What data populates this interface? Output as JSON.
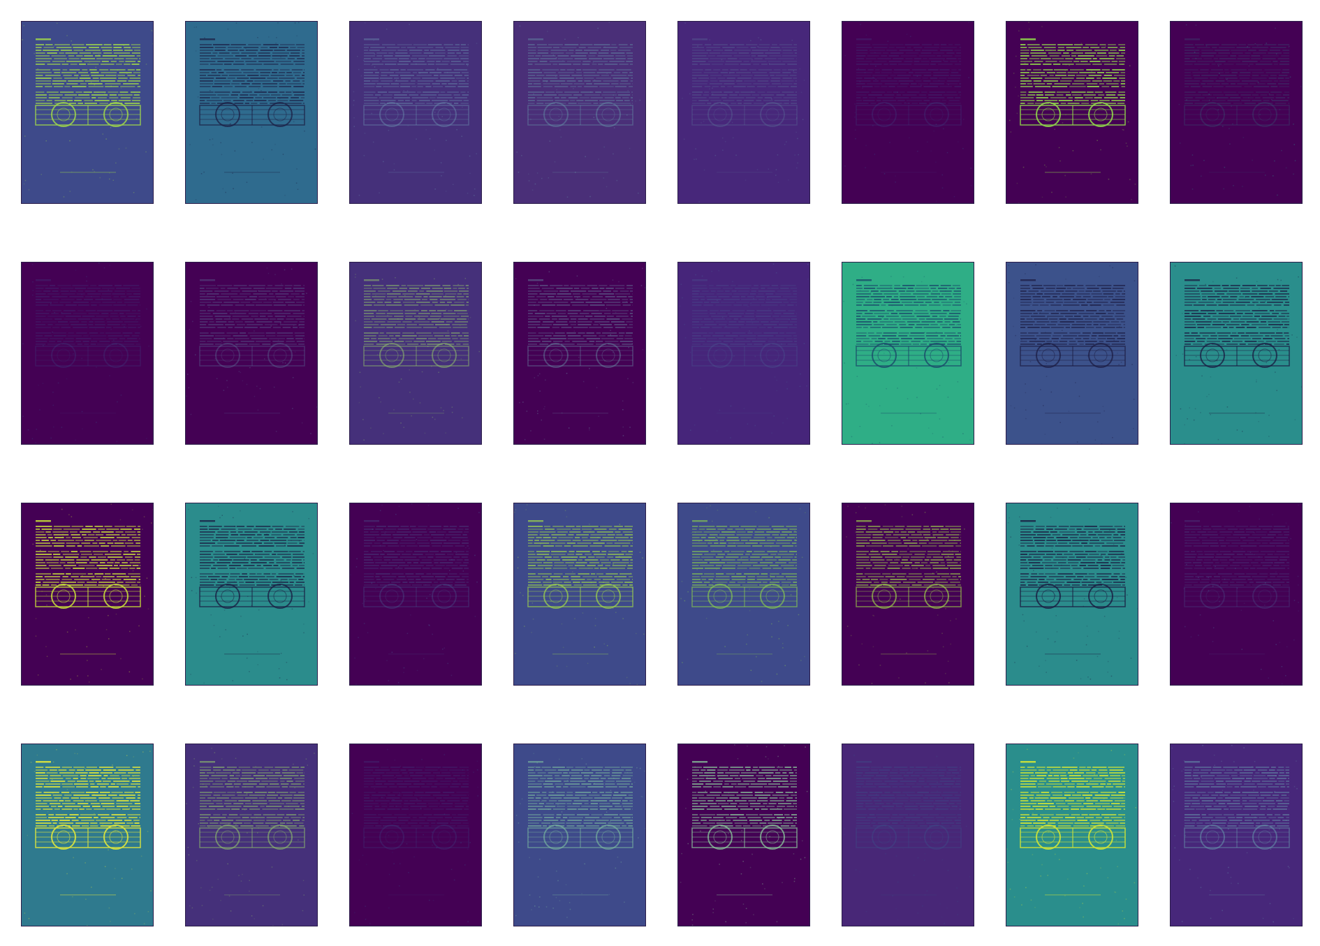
{
  "colormap": "viridis",
  "colormap_stops": [
    "#440154",
    "#482777",
    "#3f4a8a",
    "#31678e",
    "#26838f",
    "#1f9d8a",
    "#6cce5a",
    "#b6de2b",
    "#fee825"
  ],
  "feature_maps": {
    "rows": 4,
    "columns": 8,
    "tiles": [
      {
        "background": "#3e4a8a",
        "text_highlight": "#9fd64a",
        "intensity": 0.85
      },
      {
        "background": "#2f6b8e",
        "text_highlight": "#1a1a40",
        "intensity": 0.7
      },
      {
        "background": "#45307a",
        "text_highlight": "#6a8fb0",
        "intensity": 0.45
      },
      {
        "background": "#4a2f78",
        "text_highlight": "#6a9fb0",
        "intensity": 0.4
      },
      {
        "background": "#47277a",
        "text_highlight": "#5f7fa0",
        "intensity": 0.3
      },
      {
        "background": "#440154",
        "text_highlight": "#3b4f8a",
        "intensity": 0.25
      },
      {
        "background": "#440154",
        "text_highlight": "#8fd64a",
        "intensity": 0.9
      },
      {
        "background": "#440154",
        "text_highlight": "#2f8f8e",
        "intensity": 0.2
      },
      {
        "background": "#440154",
        "text_highlight": "#3b4f8a",
        "intensity": 0.25
      },
      {
        "background": "#440154",
        "text_highlight": "#5f7fa0",
        "intensity": 0.35
      },
      {
        "background": "#45307a",
        "text_highlight": "#8fbf6a",
        "intensity": 0.55
      },
      {
        "background": "#440154",
        "text_highlight": "#6fa0b0",
        "intensity": 0.4
      },
      {
        "background": "#46257a",
        "text_highlight": "#4a6a9a",
        "intensity": 0.25
      },
      {
        "background": "#2fae86",
        "text_highlight": "#1a4a6a",
        "intensity": 0.8
      },
      {
        "background": "#3c528b",
        "text_highlight": "#1a1a40",
        "intensity": 0.7
      },
      {
        "background": "#2a8e8c",
        "text_highlight": "#1a1a40",
        "intensity": 0.75
      },
      {
        "background": "#440154",
        "text_highlight": "#c8e03a",
        "intensity": 0.85
      },
      {
        "background": "#2b8c8c",
        "text_highlight": "#1a1a40",
        "intensity": 0.75
      },
      {
        "background": "#440154",
        "text_highlight": "#4a6a9a",
        "intensity": 0.3
      },
      {
        "background": "#3e4a8a",
        "text_highlight": "#9fd64a",
        "intensity": 0.7
      },
      {
        "background": "#3e4a8a",
        "text_highlight": "#8fd64a",
        "intensity": 0.6
      },
      {
        "background": "#440154",
        "text_highlight": "#9fd64a",
        "intensity": 0.65
      },
      {
        "background": "#2b8c8c",
        "text_highlight": "#1a1a40",
        "intensity": 0.8
      },
      {
        "background": "#440154",
        "text_highlight": "#4a6a9a",
        "intensity": 0.25
      },
      {
        "background": "#2f7a8e",
        "text_highlight": "#d6e040",
        "intensity": 0.95
      },
      {
        "background": "#45307a",
        "text_highlight": "#8fbf6a",
        "intensity": 0.6
      },
      {
        "background": "#440154",
        "text_highlight": "#3b4f8a",
        "intensity": 0.25
      },
      {
        "background": "#3e4a8a",
        "text_highlight": "#7fbfa0",
        "intensity": 0.6
      },
      {
        "background": "#440154",
        "text_highlight": "#8fd6a0",
        "intensity": 0.7
      },
      {
        "background": "#482777",
        "text_highlight": "#3b4f8a",
        "intensity": 0.4
      },
      {
        "background": "#2a8e8c",
        "text_highlight": "#c8e03a",
        "intensity": 0.95
      },
      {
        "background": "#47277a",
        "text_highlight": "#6a9fb0",
        "intensity": 0.5
      }
    ]
  }
}
